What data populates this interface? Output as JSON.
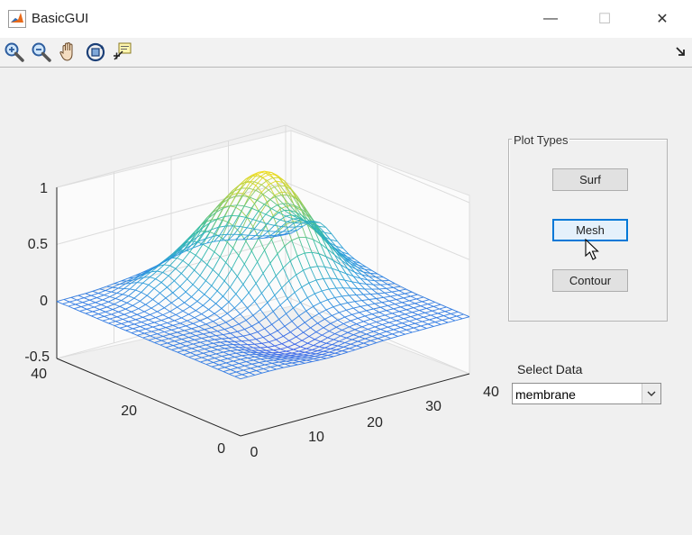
{
  "window": {
    "title": "BasicGUI",
    "controls": {
      "minimize": "—",
      "maximize": "☐",
      "close": "✕"
    }
  },
  "toolbar": {
    "tools": [
      "zoom-in-icon",
      "zoom-out-icon",
      "pan-icon",
      "rotate-3d-icon",
      "data-cursor-icon"
    ]
  },
  "colors": {
    "accent": "#0078d7",
    "plot_low": "#3d5eea",
    "plot_high": "#f7e21c"
  },
  "chart_data": {
    "type": "surface",
    "style": "mesh",
    "dataset": "membrane",
    "colormap": "parula",
    "x_ticks": [
      "0",
      "10",
      "20",
      "30",
      "40"
    ],
    "y_ticks": [
      "0",
      "20",
      "40"
    ],
    "z_ticks": [
      "-0.5",
      "0",
      "0.5",
      "1"
    ],
    "xlim": [
      0,
      40
    ],
    "ylim": [
      0,
      40
    ],
    "zlim": [
      -0.5,
      1
    ],
    "grid": true
  },
  "panel": {
    "title": "Plot Types",
    "buttons": [
      {
        "label": "Surf"
      },
      {
        "label": "Mesh"
      },
      {
        "label": "Contour"
      }
    ]
  },
  "select_data": {
    "label": "Select Data",
    "value": "membrane"
  }
}
